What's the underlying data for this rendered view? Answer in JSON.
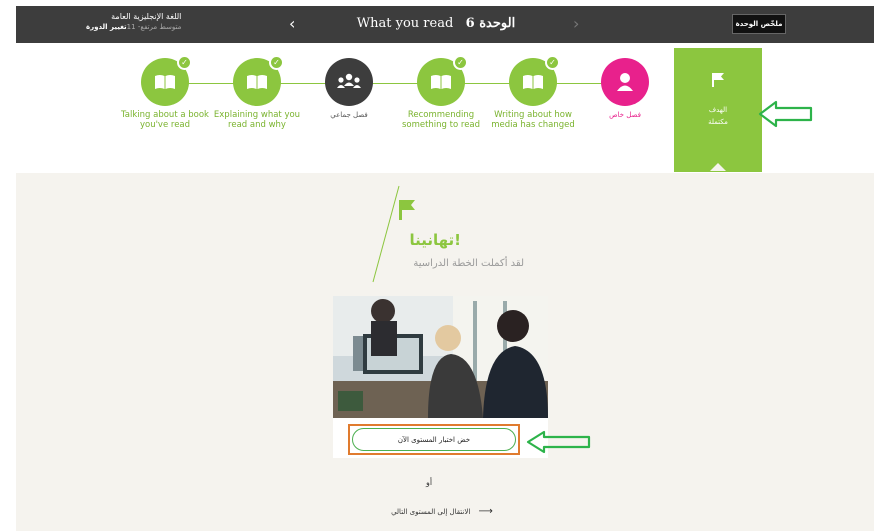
{
  "topbar": {
    "course_name": "اللغة الإنجليزية العامة",
    "course_level": "متوسط مرتفع- 11",
    "change_course": "تغيير الدورة",
    "unit_number": "الوحدة 6",
    "unit_name": "What you read",
    "prev_icon": "‹",
    "next_icon": "›",
    "summary_button": "ملخّص الوحدة"
  },
  "steps": [
    {
      "label": "Talking about a book you've read",
      "icon": "book-icon",
      "status": "completed"
    },
    {
      "label": "Explaining what you read and why",
      "icon": "book-icon",
      "status": "completed"
    },
    {
      "label": "فصل جماعي",
      "icon": "group-icon",
      "status": "group"
    },
    {
      "label": "Recommending something to read",
      "icon": "book-icon",
      "status": "completed"
    },
    {
      "label": "Writing about how media has changed",
      "icon": "book-icon",
      "status": "completed"
    },
    {
      "label": "فصل خاص",
      "icon": "person-icon",
      "status": "private"
    }
  ],
  "goal": {
    "label": "الهدف",
    "status": "مكتملة",
    "icon": "flag-icon"
  },
  "content": {
    "congrats": "تهانينا!",
    "completed_text": "لقد أكملت الخطة الدراسية",
    "test_button": "خض اختبار المستوى الآن",
    "or": "أو",
    "next_level_link": "الانتقال إلى المستوى التالي",
    "next_arrow": "⟶"
  },
  "colors": {
    "green": "#8cc63f",
    "pink": "#e8218c",
    "dark": "#3d3d3d",
    "annotation_green": "#2db34a",
    "annotation_orange": "#e07b2e"
  }
}
